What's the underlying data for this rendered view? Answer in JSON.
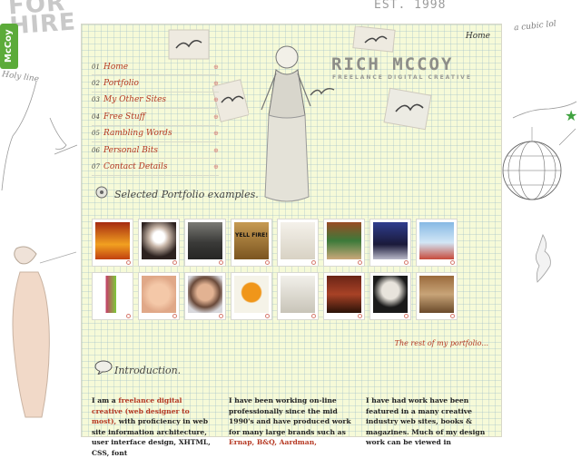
{
  "background": {
    "for_hire": "FOR HIRE",
    "mccoy_tab": "McCoy",
    "est": "EST. 1998",
    "scribble_note": "a cubic lol",
    "left_note": "Holy line"
  },
  "header": {
    "home_link": "Home",
    "logo": "RICH MCCOY",
    "tagline": "FREELANCE  DIGITAL  CREATIVE"
  },
  "nav": {
    "items": [
      {
        "num": "01",
        "label": "Home"
      },
      {
        "num": "02",
        "label": "Portfolio"
      },
      {
        "num": "03",
        "label": "My Other Sites"
      },
      {
        "num": "04",
        "label": "Free Stuff"
      },
      {
        "num": "05",
        "label": "Rambling Words"
      },
      {
        "num": "06",
        "label": "Personal Bits"
      },
      {
        "num": "07",
        "label": "Contact Details"
      }
    ]
  },
  "portfolio": {
    "title": "Selected Portfolio examples.",
    "thumb_text": {
      "yell": "YELL FIRE!"
    },
    "rest_link": "The rest of my portfolio..."
  },
  "intro": {
    "title": "Introduction.",
    "col1": {
      "lead": "I am a ",
      "link": "freelance digital creative (web designer to most),",
      "rest": " with proficiency in web site information architecture, user interface design, XHTML, CSS, font"
    },
    "col2": {
      "text": "I have been working on-line professionally since the mid 1990's and have produced work for many large brands such as ",
      "links": "Ernap, B&Q, Aardman,"
    },
    "col3": {
      "text": "I have had work have been featured in a many creative industry web sites, books & magazines. Much of my design work can be viewed in"
    }
  },
  "colors": {
    "accent_red": "#b53822",
    "paper": "#f6fad8",
    "green": "#5cab3a"
  }
}
